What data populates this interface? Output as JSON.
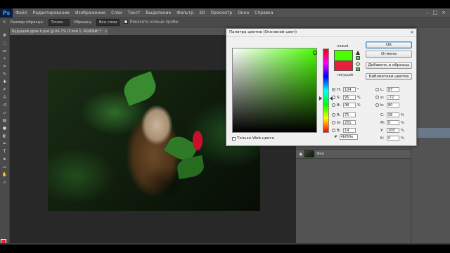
{
  "menu": {
    "logo": "Ps",
    "items": [
      "Файл",
      "Редактирование",
      "Изображение",
      "Слои",
      "Текст",
      "Выделение",
      "Фильтр",
      "3D",
      "Просмотр",
      "Окно",
      "Справка"
    ]
  },
  "options_bar": {
    "sample_size_label": "Размер образца:",
    "sample_size_value": "Точка",
    "sample_layers_value": "Все слои",
    "show_ring_label": "Показать кольцо пробы"
  },
  "document_tab": {
    "title": "Будущий урок 6.psd @ 66,7% (Слой 1, RGB/8#) *",
    "close": "×"
  },
  "color_picker": {
    "title": "Палитра цветов (Основной цвет)",
    "close": "×",
    "label_new": "новый",
    "label_current": "текущий",
    "new_color": "#4bff00",
    "current_color": "#e8203b",
    "buttons": {
      "ok": "OK",
      "cancel": "Отмена",
      "add_to_swatches": "Добавить в образцы",
      "color_libraries": "Библиотеки цветов"
    },
    "web_only_label": "Только Web-цвета",
    "hex_label": "#",
    "hex_value": "4bf60e",
    "fields_left": [
      {
        "label": "H:",
        "value": "104",
        "unit": "°",
        "selected": true
      },
      {
        "label": "S:",
        "value": "95",
        "unit": "%",
        "selected": false
      },
      {
        "label": "B:",
        "value": "98",
        "unit": "%",
        "selected": false
      },
      {
        "label": "R:",
        "value": "75",
        "unit": "",
        "selected": false
      },
      {
        "label": "G:",
        "value": "251",
        "unit": "",
        "selected": false
      },
      {
        "label": "B:",
        "value": "14",
        "unit": "",
        "selected": false
      }
    ],
    "fields_right_lab": [
      {
        "label": "L:",
        "value": "87"
      },
      {
        "label": "a:",
        "value": "-72"
      },
      {
        "label": "b:",
        "value": "80"
      }
    ],
    "fields_right_cmyk": [
      {
        "label": "C:",
        "value": "58",
        "unit": "%"
      },
      {
        "label": "M:",
        "value": "0",
        "unit": "%"
      },
      {
        "label": "Y:",
        "value": "100",
        "unit": "%"
      },
      {
        "label": "K:",
        "value": "0",
        "unit": "%"
      }
    ]
  },
  "layers": {
    "bg_name": "Фон"
  },
  "colors": {
    "foreground": "#e8203b",
    "background": "#ffffff"
  }
}
